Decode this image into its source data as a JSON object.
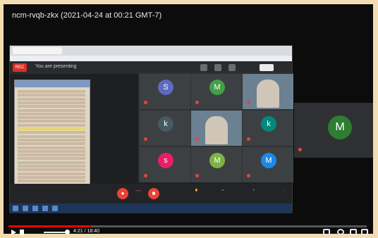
{
  "video": {
    "title": "ncm-rvqb-zkx (2021-04-24 at 00:21 GMT-7)",
    "current_time": "4:21",
    "duration": "18:40",
    "time_display": "4:21 / 18:40",
    "progress": 0.23
  },
  "meet": {
    "rec_label": "REC",
    "presenting_text": "You are presenting"
  },
  "participants": [
    {
      "initial": "S",
      "color": "#5c6bc0"
    },
    {
      "initial": "M",
      "color": "#43a047"
    },
    {
      "initial": "",
      "color": "",
      "video": true
    },
    {
      "initial": "k",
      "color": "#455a64"
    },
    {
      "initial": "",
      "color": "",
      "video": true
    },
    {
      "initial": "k",
      "color": "#00897b"
    },
    {
      "initial": "s",
      "color": "#e91e63"
    },
    {
      "initial": "M",
      "color": "#7cb342"
    },
    {
      "initial": "M",
      "color": "#1e88e5"
    }
  ],
  "right_tile": {
    "initial": "M",
    "color": "#2e7d32"
  },
  "colors": {
    "accent_red": "#ff0000",
    "meet_bg": "#303134"
  }
}
